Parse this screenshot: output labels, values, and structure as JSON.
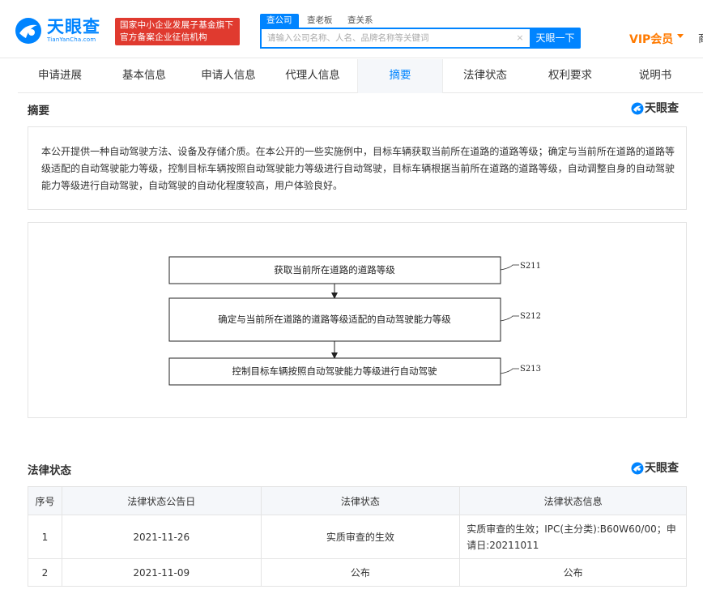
{
  "header": {
    "logo_text": "天眼查",
    "logo_sub": "TianYanCha.com",
    "gov_badge_line1": "国家中小企业发展子基金旗下",
    "gov_badge_line2": "官方备案企业征信机构",
    "search_tabs": [
      "查公司",
      "查老板",
      "查关系"
    ],
    "search_placeholder": "请输入公司名称、人名、品牌名称等关键词",
    "search_clear": "×",
    "search_button": "天眼一下",
    "vip_label": "VIP会员",
    "edge_text": "商"
  },
  "tabs": [
    "申请进展",
    "基本信息",
    "申请人信息",
    "代理人信息",
    "摘要",
    "法律状态",
    "权利要求",
    "说明书"
  ],
  "active_tab": "摘要",
  "abstract": {
    "title": "摘要",
    "watermark": "天眼查",
    "text": "本公开提供一种自动驾驶方法、设备及存储介质。在本公开的一些实施例中，目标车辆获取当前所在道路的道路等级；确定与当前所在道路的道路等级适配的自动驾驶能力等级，控制目标车辆按照自动驾驶能力等级进行自动驾驶，目标车辆根据当前所在道路的道路等级，自动调整自身的自动驾驶能力等级进行自动驾驶，自动驾驶的自动化程度较高，用户体验良好。"
  },
  "flowchart": {
    "steps": [
      {
        "text": "获取当前所在道路的道路等级",
        "label": "S211"
      },
      {
        "text": "确定与当前所在道路的道路等级适配的自动驾驶能力等级",
        "label": "S212"
      },
      {
        "text": "控制目标车辆按照自动驾驶能力等级进行自动驾驶",
        "label": "S213"
      }
    ]
  },
  "legal": {
    "title": "法律状态",
    "watermark": "天眼查",
    "columns": [
      "序号",
      "法律状态公告日",
      "法律状态",
      "法律状态信息"
    ],
    "rows": [
      {
        "no": "1",
        "date": "2021-11-26",
        "status": "实质审查的生效",
        "info": "实质审查的生效；IPC(主分类):B60W60/00；申请日:20211011"
      },
      {
        "no": "2",
        "date": "2021-11-09",
        "status": "公布",
        "info": "公布"
      }
    ]
  },
  "colors": {
    "brand_blue": "#0084ff",
    "badge_red": "#e03a2f",
    "vip_orange": "#ff7a00"
  }
}
